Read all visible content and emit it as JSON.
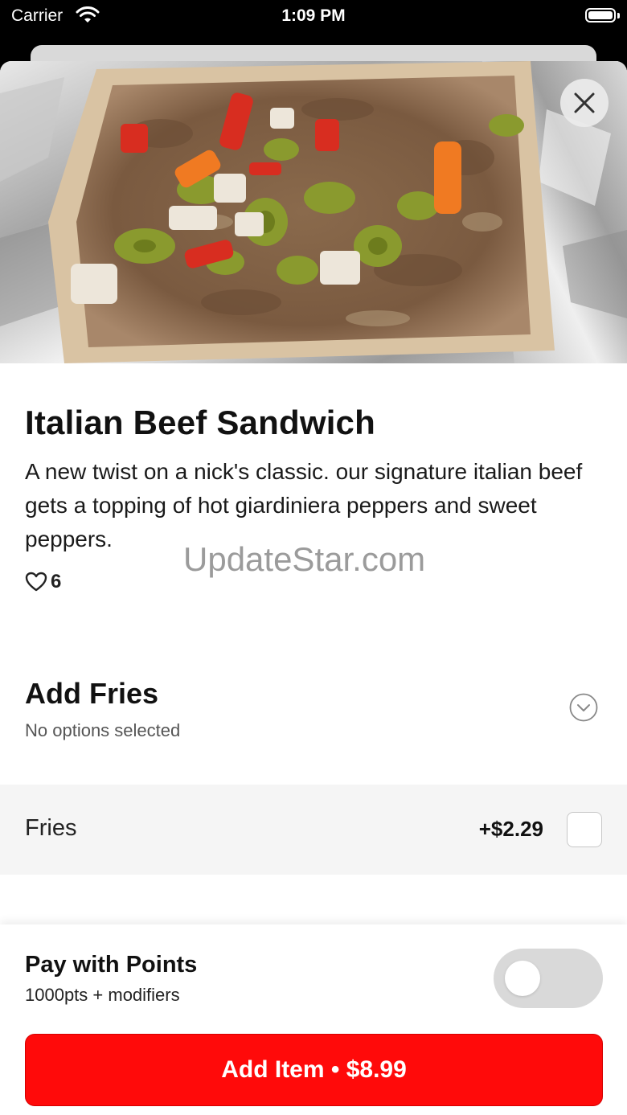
{
  "status_bar": {
    "carrier": "Carrier",
    "time": "1:09 PM"
  },
  "icons": {
    "close": "close-icon",
    "heart": "heart-icon",
    "chevron": "chevron-down-icon",
    "wifi": "wifi-icon",
    "battery": "battery-icon"
  },
  "item": {
    "title": "Italian Beef Sandwich",
    "description": "A new twist on a nick's classic. our signature italian beef gets a topping of hot giardiniera peppers and sweet peppers.",
    "likes": "6"
  },
  "watermark": "UpdateStar.com",
  "modifier_group": {
    "title": "Add Fries",
    "subtitle": "No options selected",
    "options": [
      {
        "name": "Fries",
        "price": "+$2.29",
        "checked": false
      }
    ]
  },
  "points": {
    "title": "Pay with Points",
    "subtitle": "1000pts + modifiers",
    "enabled": false
  },
  "add_button": {
    "label": "Add Item • $8.99"
  },
  "colors": {
    "accent": "#ff0a0a",
    "toggle_off": "#d9d9d9",
    "option_row_bg": "#f5f5f5"
  }
}
